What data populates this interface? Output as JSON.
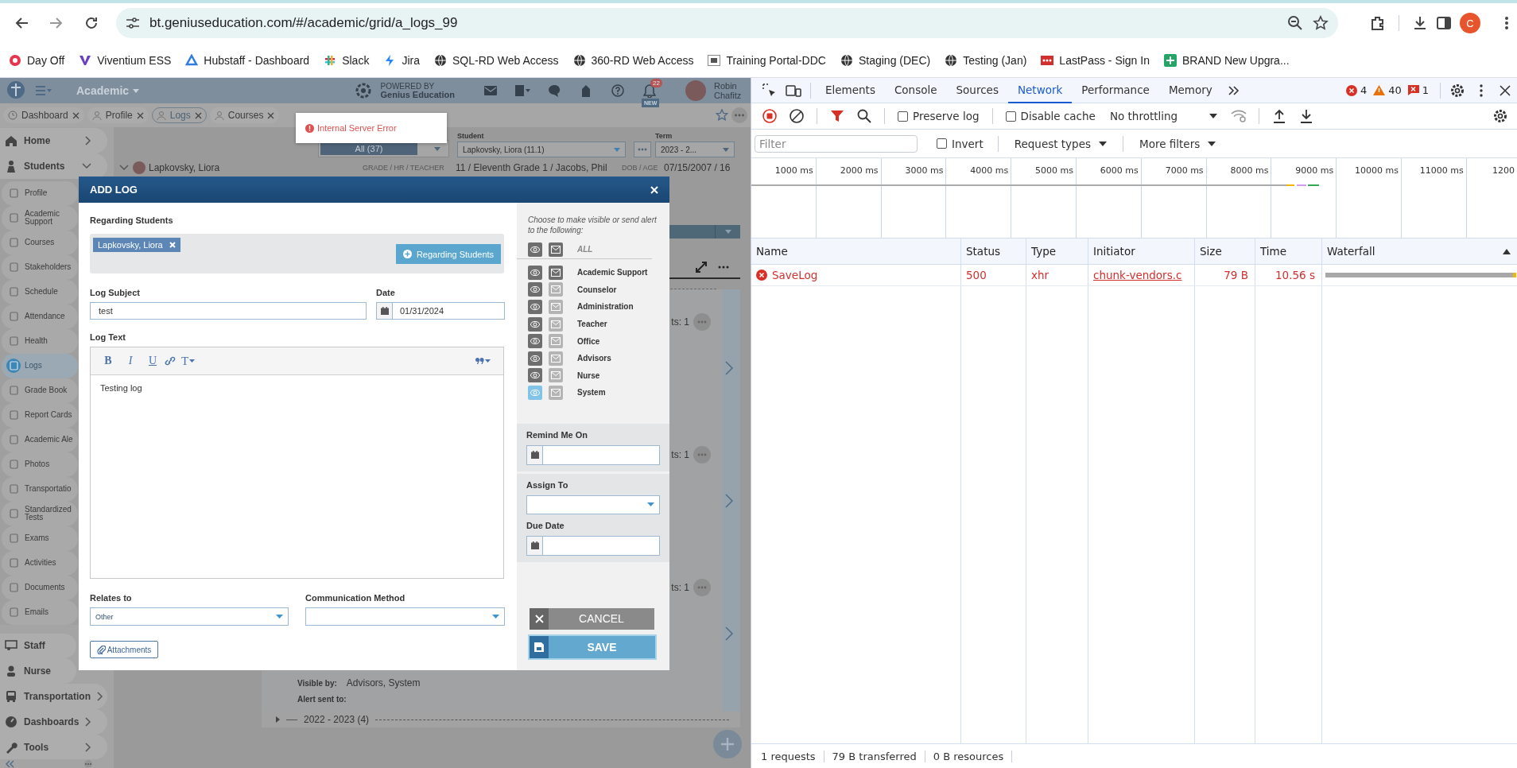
{
  "browser": {
    "url": "bt.geniuseducation.com/#/academic/grid/a_logs_99",
    "profile_initial": "C",
    "bookmarks": [
      {
        "label": "Day Off"
      },
      {
        "label": "Viventium ESS"
      },
      {
        "label": "Hubstaff - Dashboard"
      },
      {
        "label": "Slack"
      },
      {
        "label": "Jira"
      },
      {
        "label": "SQL-RD Web Access"
      },
      {
        "label": "360-RD Web Access"
      },
      {
        "label": "Training Portal-DDC"
      },
      {
        "label": "Staging (DEC)"
      },
      {
        "label": "Testing (Jan)"
      },
      {
        "label": "LastPass - Sign In"
      },
      {
        "label": "BRAND New Upgra..."
      }
    ]
  },
  "app": {
    "module": "Academic",
    "powered_by": "POWERED BY",
    "powered_name": "Genius Education",
    "notifications": "22",
    "new_label": "NEW",
    "user_name": "Robin Chafitz",
    "tabs": [
      {
        "label": "Dashboard",
        "selected": false
      },
      {
        "label": "Profile",
        "selected": false
      },
      {
        "label": "Logs",
        "selected": true
      },
      {
        "label": "Courses",
        "selected": false
      }
    ],
    "sidebar": [
      {
        "label": "Home",
        "expanded": false
      },
      {
        "label": "Students",
        "expanded": true,
        "children": [
          {
            "label": "Profile",
            "selected": false
          },
          {
            "label": "Academic Support",
            "selected": false
          },
          {
            "label": "Courses",
            "selected": false
          },
          {
            "label": "Stakeholders",
            "selected": false
          },
          {
            "label": "Schedule",
            "selected": false
          },
          {
            "label": "Attendance",
            "selected": false
          },
          {
            "label": "Health",
            "selected": false
          },
          {
            "label": "Logs",
            "selected": true
          },
          {
            "label": "Grade Book",
            "selected": false
          },
          {
            "label": "Report Cards",
            "selected": false
          },
          {
            "label": "Academic Ale",
            "selected": false
          },
          {
            "label": "Photos",
            "selected": false
          },
          {
            "label": "Transportatio",
            "selected": false
          },
          {
            "label": "Standardized Tests",
            "selected": false
          },
          {
            "label": "Exams",
            "selected": false
          },
          {
            "label": "Activities",
            "selected": false
          },
          {
            "label": "Documents",
            "selected": false
          },
          {
            "label": "Emails",
            "selected": false
          }
        ]
      },
      {
        "label": "Staff"
      },
      {
        "label": "Nurse"
      },
      {
        "label": "Transportation",
        "expanded": false
      },
      {
        "label": "Dashboards",
        "expanded": false
      },
      {
        "label": "Tools",
        "expanded": false
      }
    ],
    "toast": {
      "message": "Internal Server Error"
    },
    "filters": {
      "group": "All (37)",
      "student_label": "Student",
      "student": "Lapkovsky, Liora (11.1)",
      "term_label": "Term",
      "term": "2023 - 2..."
    },
    "student_row": {
      "name": "Lapkovsky, Liora",
      "grade_label": "GRADE / HR / TEACHER",
      "grade": "11 / Eleventh Grade 1 / Jacobs, Phil",
      "dob_label": "DOB / AGE",
      "dob": "07/15/2007 / 16"
    },
    "log_cards": [
      {
        "count": "ts: 1"
      },
      {
        "count": "ts: 1"
      },
      {
        "count": "ts: 1"
      }
    ],
    "visible_by_label": "Visible by:",
    "visible_by": "Advisors, System",
    "alert_label": "Alert sent to:",
    "year_group": "2022 - 2023 (4)"
  },
  "modal": {
    "title": "ADD LOG",
    "regarding_label": "Regarding Students",
    "students": [
      {
        "name": "Lapkovsky, Liora"
      }
    ],
    "add_student_button": "Regarding Students",
    "subject_label": "Log Subject",
    "subject": "test",
    "date_label": "Date",
    "date": "01/31/2024",
    "text_label": "Log Text",
    "format_buttons": [
      {
        "label": "B"
      },
      {
        "label": "I"
      },
      {
        "label": "U"
      }
    ],
    "style_button": "T",
    "text": "Testing log",
    "relates_label": "Relates to",
    "relates": "Other",
    "method_label": "Communication Method",
    "attachments_button": "Attachments",
    "audience_hint": "Choose to make visible or send alert to the following:",
    "audience": [
      {
        "label": "ALL",
        "kind": "all",
        "visible": true,
        "locked": false,
        "alert": true
      },
      {
        "label": "Academic Support",
        "kind": "group",
        "visible": true,
        "locked": false,
        "alert": true
      },
      {
        "label": "Counselor",
        "kind": "group",
        "visible": true,
        "locked": false,
        "alert": false
      },
      {
        "label": "Administration",
        "kind": "group",
        "visible": true,
        "locked": false,
        "alert": false
      },
      {
        "label": "Teacher",
        "kind": "group",
        "visible": true,
        "locked": false,
        "alert": false
      },
      {
        "label": "Office",
        "kind": "group",
        "visible": true,
        "locked": false,
        "alert": false
      },
      {
        "label": "Advisors",
        "kind": "group",
        "visible": true,
        "locked": false,
        "alert": false
      },
      {
        "label": "Nurse",
        "kind": "group",
        "visible": true,
        "locked": false,
        "alert": false
      },
      {
        "label": "System",
        "kind": "group",
        "visible": true,
        "locked": true,
        "alert": false
      }
    ],
    "remind_label": "Remind Me On",
    "assign_label": "Assign To",
    "due_label": "Due Date",
    "cancel_button": "CANCEL",
    "save_button": "SAVE"
  },
  "devtools": {
    "tabs": [
      {
        "label": "Elements",
        "selected": false
      },
      {
        "label": "Console",
        "selected": false
      },
      {
        "label": "Sources",
        "selected": false
      },
      {
        "label": "Network",
        "selected": true
      },
      {
        "label": "Performance",
        "selected": false
      },
      {
        "label": "Memory",
        "selected": false
      }
    ],
    "errors": "4",
    "warnings": "40",
    "issues": "1",
    "recording": true,
    "preserve_log": {
      "label": "Preserve log",
      "checked": false
    },
    "disable_cache": {
      "label": "Disable cache",
      "checked": false
    },
    "throttling": "No throttling",
    "filter_placeholder": "Filter",
    "invert": {
      "label": "Invert",
      "checked": false
    },
    "request_types": "Request types",
    "more_filters": "More filters",
    "timeline_ticks": [
      "1000 ms",
      "2000 ms",
      "3000 ms",
      "4000 ms",
      "5000 ms",
      "6000 ms",
      "7000 ms",
      "8000 ms",
      "9000 ms",
      "10000 ms",
      "11000 ms",
      "1200"
    ],
    "columns": [
      "Name",
      "Status",
      "Type",
      "Initiator",
      "Size",
      "Time",
      "Waterfall"
    ],
    "requests": [
      {
        "name": "SaveLog",
        "status": "500",
        "type": "xhr",
        "initiator": "chunk-vendors.c",
        "size": "79 B",
        "time": "10.56 s",
        "failed": true
      }
    ],
    "status": [
      "1 requests",
      "79 B transferred",
      "0 B resources"
    ]
  }
}
